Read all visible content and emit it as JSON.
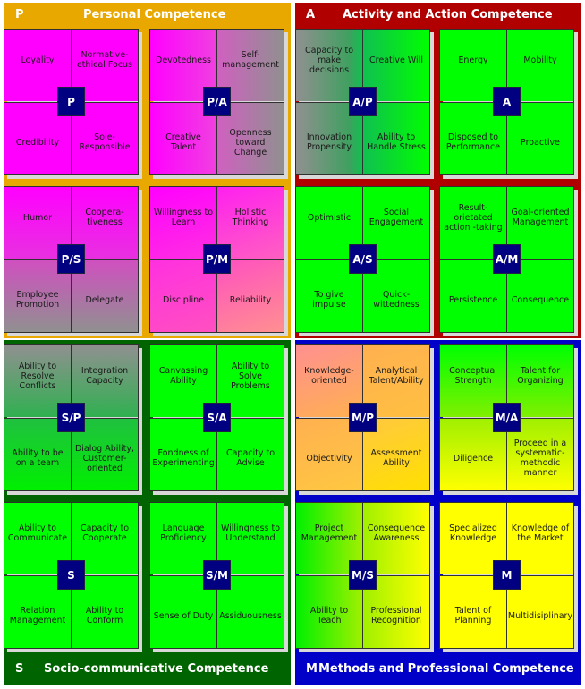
{
  "panels": {
    "P": {
      "letter": "P",
      "title": "Personal Competence",
      "color": "#E8A800"
    },
    "A": {
      "letter": "A",
      "title": "Activity and Action Competence",
      "color": "#B00000"
    },
    "S": {
      "letter": "S",
      "title": "Socio-communicative Competence",
      "color": "#006400"
    },
    "M": {
      "letter": "M",
      "title": "Methods and Professional Competence",
      "color": "#0000C8"
    }
  },
  "cards": {
    "p": {
      "badge": "P",
      "tl": "Loyality",
      "tr": "Normative-ethical Focus",
      "bl": "Credibility",
      "br": "Sole-Responsible"
    },
    "pa": {
      "badge": "P/A",
      "tl": "Devotedness",
      "tr": "Self-management",
      "bl": "Creative Talent",
      "br": "Openness toward Change"
    },
    "ap": {
      "badge": "A/P",
      "tl": "Capacity to make decisions",
      "tr": "Creative Will",
      "bl": "Innovation Propensity",
      "br": "Ability to Handle Stress"
    },
    "a": {
      "badge": "A",
      "tl": "Energy",
      "tr": "Mobility",
      "bl": "Disposed to Performance",
      "br": "Proactive"
    },
    "ps": {
      "badge": "P/S",
      "tl": "Humor",
      "tr": "Coopera-tiveness",
      "bl": "Employee Promotion",
      "br": "Delegate"
    },
    "pm": {
      "badge": "P/M",
      "tl": "Willingness to Learn",
      "tr": "Holistic Thinking",
      "bl": "Discipline",
      "br": "Reliability"
    },
    "as": {
      "badge": "A/S",
      "tl": "Optimistic",
      "tr": "Social Engagement",
      "bl": "To give impulse",
      "br": "Quick-wittedness"
    },
    "am": {
      "badge": "A/M",
      "tl": "Result-orietated action -taking",
      "tr": "Goal-oriented Management",
      "bl": "Persistence",
      "br": "Consequence"
    },
    "sp": {
      "badge": "S/P",
      "tl": "Ability to Resolve Conflicts",
      "tr": "Integration Capacity",
      "bl": "Ability to be on a team",
      "br": "Dialog Ability, Customer-oriented"
    },
    "sa": {
      "badge": "S/A",
      "tl": "Canvassing Ability",
      "tr": "Ability to Solve Problems",
      "bl": "Fondness of Experimenting",
      "br": "Capacity to Advise"
    },
    "mp": {
      "badge": "M/P",
      "tl": "Knowledge-oriented",
      "tr": "Analytical Talent/Ability",
      "bl": "Objectivity",
      "br": "Assessment Ability"
    },
    "ma": {
      "badge": "M/A",
      "tl": "Conceptual Strength",
      "tr": "Talent for Organizing",
      "bl": "Diligence",
      "br": "Proceed in a systematic-methodic manner"
    },
    "s": {
      "badge": "S",
      "tl": "Ability to Communicate",
      "tr": "Capacity to Cooperate",
      "bl": "Relation Management",
      "br": "Ability to Conform"
    },
    "sm": {
      "badge": "S/M",
      "tl": "Language Proficiency",
      "tr": "Willingness to Understand",
      "bl": "Sense of Duty",
      "br": "Assiduousness"
    },
    "ms": {
      "badge": "M/S",
      "tl": "Project Management",
      "tr": "Consequence Awareness",
      "bl": "Ability to Teach",
      "br": "Professional Recognition"
    },
    "m": {
      "badge": "M",
      "tl": "Specialized Knowledge",
      "tr": "Knowledge of the Market",
      "bl": "Talent of Planning",
      "br": "Multidisiplinary"
    }
  },
  "colors": {
    "magenta": "#FF00FF",
    "green": "#00FF00",
    "gray": "#909090",
    "yellow": "#FFFF00",
    "salmon": "#FF9090",
    "orange": "#FFC040",
    "badge": "#000080"
  }
}
